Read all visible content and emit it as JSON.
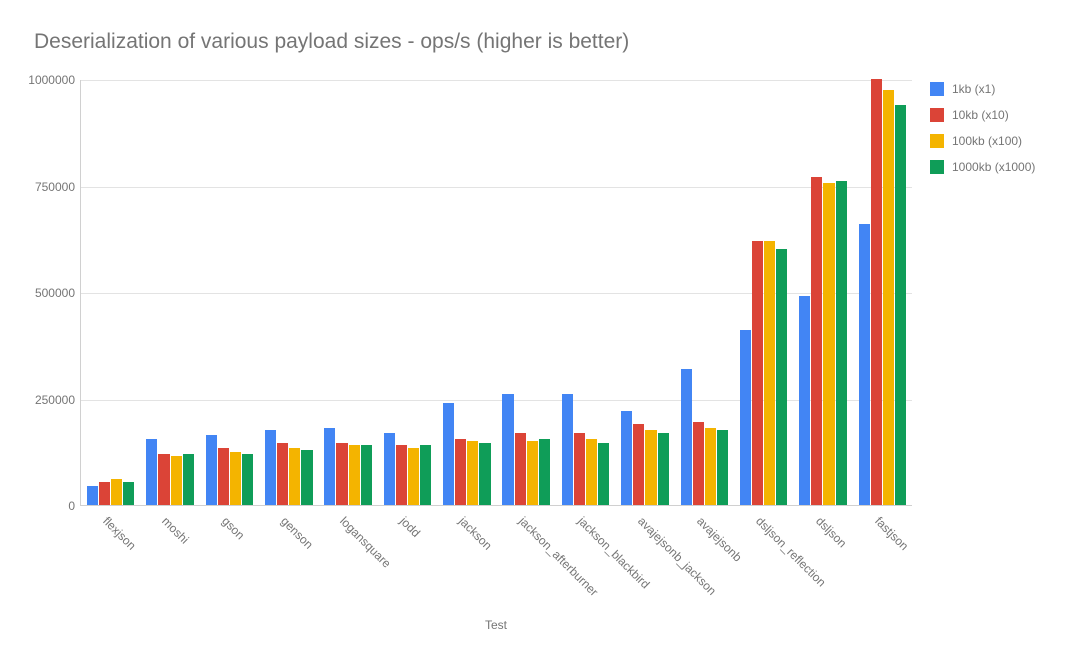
{
  "chart_data": {
    "type": "bar",
    "title": "Deserialization of various payload sizes  - ops/s (higher is better)",
    "xlabel": "Test",
    "ylabel": "",
    "ylim": [
      0,
      1000000
    ],
    "yticks": [
      0,
      250000,
      500000,
      750000,
      1000000
    ],
    "categories": [
      "flexjson",
      "moshi",
      "gson",
      "genson",
      "logansquare",
      "jodd",
      "jackson",
      "jackson_afterburner",
      "jackson_blackbird",
      "avajejsonb_jackson",
      "avajejsonb",
      "dsljson_reflection",
      "dsljson",
      "fastjson"
    ],
    "series": [
      {
        "name": "1kb (x1)",
        "color": "#4285F4",
        "values": [
          45000,
          155000,
          165000,
          175000,
          180000,
          170000,
          240000,
          260000,
          260000,
          220000,
          320000,
          410000,
          490000,
          660000
        ]
      },
      {
        "name": "10kb (x10)",
        "color": "#DB4437",
        "values": [
          55000,
          120000,
          135000,
          145000,
          145000,
          140000,
          155000,
          170000,
          170000,
          190000,
          195000,
          620000,
          770000,
          1000000
        ]
      },
      {
        "name": "100kb (x100)",
        "color": "#F4B400",
        "values": [
          60000,
          115000,
          125000,
          135000,
          140000,
          135000,
          150000,
          150000,
          155000,
          175000,
          180000,
          620000,
          755000,
          975000
        ]
      },
      {
        "name": "1000kb (x1000)",
        "color": "#0F9D58",
        "values": [
          55000,
          120000,
          120000,
          130000,
          140000,
          140000,
          145000,
          155000,
          145000,
          170000,
          175000,
          600000,
          760000,
          940000
        ]
      }
    ]
  }
}
